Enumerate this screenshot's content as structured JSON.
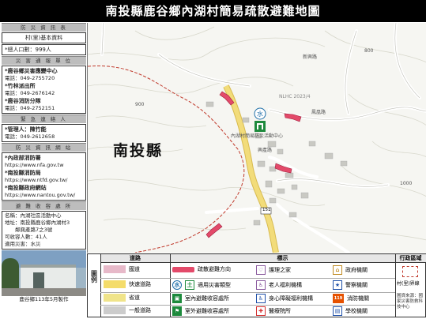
{
  "title": "南投縣鹿谷鄉內湖村簡易疏散避難地圖",
  "left_panel": {
    "section1_head": "防 災 資 訊 表",
    "basic_head": "村(里)基本資料",
    "population": "*總人口數：999人",
    "disaster_head": "災 害 通 報 單 位",
    "units": [
      {
        "name": "*鹿谷鄉災害應變中心",
        "phone": "電話：049-2755720"
      },
      {
        "name": "*竹林派出所",
        "phone": "電話：049-2676142"
      },
      {
        "name": "*鹿谷消防分隊",
        "phone": "電話：049-2752151"
      }
    ],
    "contact_head": "緊 急 連 絡 人",
    "contact_name": "*管理人：陳竹能",
    "contact_phone": "電話：049-2612658",
    "websites_head": "防 災 資 訊 網 站",
    "websites": [
      {
        "name": "*內政部消防署",
        "url": "https://www.nfa.gov.tw"
      },
      {
        "name": "*南投縣消防局",
        "url": "https://www.ntfd.gov.tw/"
      },
      {
        "name": "*南投縣政府網站",
        "url": "https://www.nantou.gov.tw/"
      }
    ],
    "shelter_head": "避 難 收 容 處 所",
    "shelter_name": "名稱：內湖社區活動中心",
    "shelter_addr1": "地址：南投縣鹿谷鄉內湖村3",
    "shelter_addr2": "　　鄰興產路7之3號",
    "shelter_capacity": "可收容人數：41人",
    "shelter_target": "適用災害：水災",
    "photo_caption": "鹿谷鄉113年5月製作"
  },
  "map": {
    "county_label": "南投縣",
    "shelter_label": "內湖村簡易防災活動中心",
    "route_badge": "151",
    "road_labels": [
      "興產路",
      "新興路",
      "鳳凰路"
    ],
    "contour_labels": [
      "800",
      "1000",
      "900"
    ],
    "point_labels": [
      "NLHC 2023/4"
    ]
  },
  "legend": {
    "head_roads": "道路",
    "head_marks": "標示",
    "head_admin": "行政區域",
    "side_label": "圖例",
    "roads": [
      {
        "label": "國道",
        "color": "#e7b9c9"
      },
      {
        "label": "快速道路",
        "color": "#f4dc6a"
      },
      {
        "label": "省道",
        "color": "#f0e48a"
      },
      {
        "label": "一般道路",
        "color": "#cccccc"
      }
    ],
    "marks": [
      [
        "疏散避難方向",
        "護理之家",
        "政府機關"
      ],
      [
        "適用災害類型",
        "老人福利機構",
        "警察機關"
      ],
      [
        "室內避難收容處所",
        "身心障礙福利機構",
        "消防機關"
      ],
      [
        "室外避難收容處所",
        "醫療院所",
        "學校機關"
      ]
    ],
    "admin_label": "村(里)界線",
    "source_note": "圖資來源：國家災害防救科技中心",
    "fire_icon_text": "119"
  },
  "colors": {
    "evac_arrow": "#e34a6a",
    "shelter_green": "#1d8a3c",
    "main_road": "#f2dc7a",
    "minor_road": "#ffffff",
    "terrain": "#f6f6f2"
  }
}
